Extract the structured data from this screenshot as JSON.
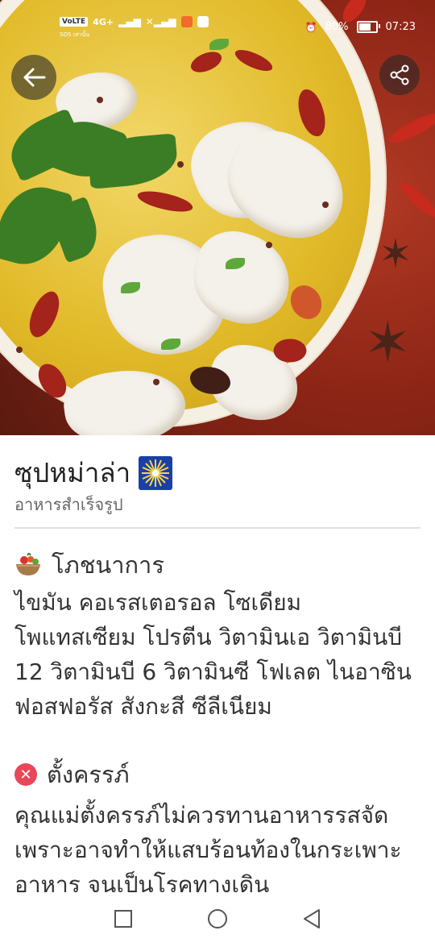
{
  "status_bar": {
    "network_badge": "VoLTE",
    "network_type": "4G+",
    "carrier_small": "SOS เท่านั้น",
    "battery_text": "80%",
    "battery_level": 0.8,
    "time": "07:23"
  },
  "header": {
    "back_icon": "arrow-left-icon",
    "share_icon": "share-icon"
  },
  "recipe": {
    "title": "ซุปหม่าล่า",
    "title_emoji": "sparkler-icon",
    "category": "อาหารสำเร็จรูป"
  },
  "sections": [
    {
      "icon": "salad-bowl-icon",
      "heading": "โภชนาการ",
      "body": "ไขมัน คอเรสเตอรอล โซเดียม โพแทสเซียม โปรตีน วิตามินเอ วิตามินบี 12 วิตามินบี 6 วิตามินซี โฟเลต ไนอาซิน ฟอสฟอรัส สังกะสี ซีลีเนียม"
    },
    {
      "icon": "x-circle-icon",
      "heading": "ตั้งครรภ์",
      "body": "คุณแม่ตั้งครรภ์ไม่ควรทานอาหารรสจัด เพราะอาจทำให้แสบร้อนท้องในกระเพาะอาหาร จนเป็นโรคทางเดิน"
    }
  ],
  "nav": {
    "recent_icon": "square-icon",
    "home_icon": "circle-icon",
    "back_icon": "triangle-back-icon"
  },
  "colors": {
    "accent_red": "#e8475a",
    "text_primary": "#222222",
    "text_secondary": "#666666"
  }
}
